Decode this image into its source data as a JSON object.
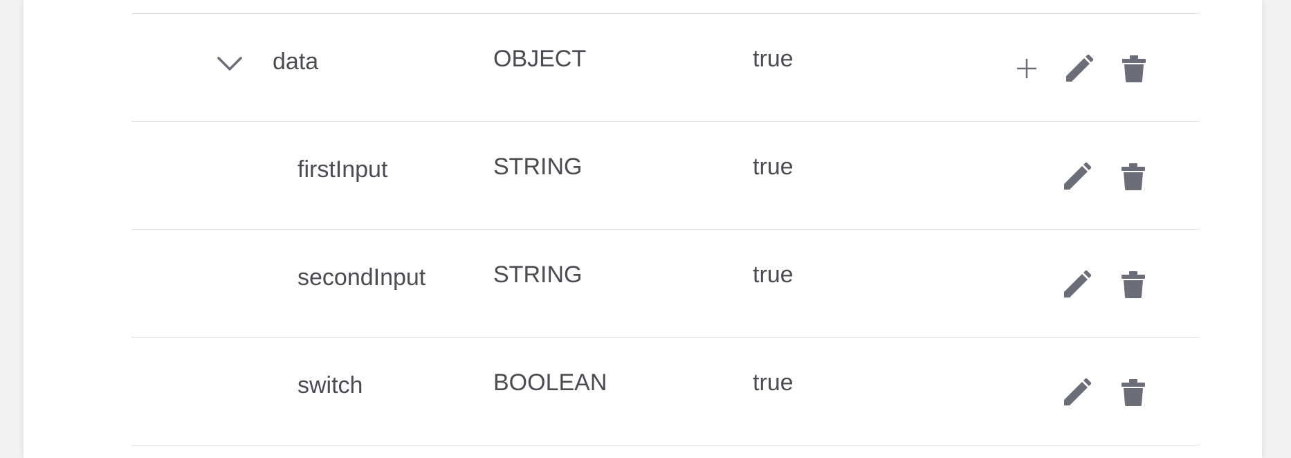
{
  "schema_table": {
    "rows": [
      {
        "name": "data",
        "type": "OBJECT",
        "required": "true",
        "expanded": true,
        "icons": [
          "chevron-down-icon",
          "plus-icon",
          "pencil-icon",
          "trash-icon"
        ]
      },
      {
        "name": "firstInput",
        "type": "STRING",
        "required": "true",
        "icons": [
          "pencil-icon",
          "trash-icon"
        ]
      },
      {
        "name": "secondInput",
        "type": "STRING",
        "required": "true",
        "icons": [
          "pencil-icon",
          "trash-icon"
        ]
      },
      {
        "name": "switch",
        "type": "BOOLEAN",
        "required": "true",
        "icons": [
          "pencil-icon",
          "trash-icon"
        ]
      }
    ]
  },
  "colors": {
    "text": "#4a4c52",
    "icon": "#6b6e78",
    "divider": "#e2e3e5",
    "background": "#f3f3f4",
    "panel": "#ffffff"
  }
}
